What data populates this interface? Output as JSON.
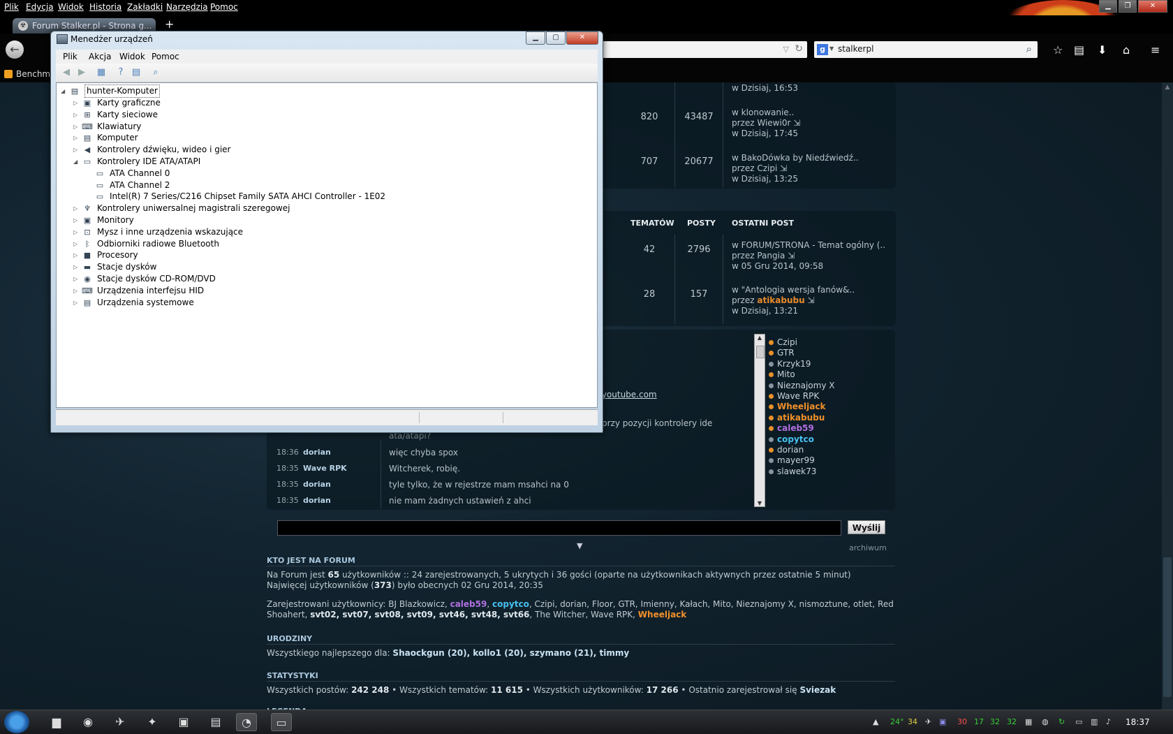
{
  "browser": {
    "menu": [
      "Plik",
      "Edycja",
      "Widok",
      "Historia",
      "Zakładki",
      "Narzędzia",
      "Pomoc"
    ],
    "tab_title": "Forum Stalker.pl - Strona g...",
    "search_query": "stalkerpl",
    "bookmark": "Benchma"
  },
  "forum": {
    "topics": [
      {
        "topics": "",
        "posts": "",
        "last_in": "",
        "last_by": "",
        "last_when": "w Dzisiaj, 16:53"
      },
      {
        "topics": "820",
        "posts": "43487",
        "last_in": "w klonowanie..",
        "last_by": "przez Wiewi0r",
        "last_when": "w Dzisiaj, 17:45"
      },
      {
        "topics": "707",
        "posts": "20677",
        "last_in": "w BakoDówka by Niedźwiedź..",
        "last_by": "przez Czipi",
        "last_when": "w Dzisiaj, 13:25"
      }
    ],
    "columns": {
      "topics": "TEMATÓW",
      "posts": "POSTY",
      "last": "OSTATNI POST"
    },
    "topics2": [
      {
        "topics": "42",
        "posts": "2796",
        "last_in": "w FORUM/STRONA - Temat ogólny (..",
        "last_by_prefix": "przez",
        "last_by": "Pangia",
        "last_when": "w 05 Gru 2014, 09:58"
      },
      {
        "topics": "28",
        "posts": "157",
        "last_in": "w \"Antologia wersja fanów&..",
        "last_by_prefix": "przez",
        "last_by": "atikabubu",
        "last_when": "w Dzisiaj, 13:21"
      }
    ]
  },
  "chat": {
    "users": [
      {
        "name": "Czipi",
        "style": "normal",
        "dot": "orange"
      },
      {
        "name": "GTR",
        "style": "normal",
        "dot": "orange"
      },
      {
        "name": "Krzyk19",
        "style": "normal",
        "dot": "grey"
      },
      {
        "name": "Mito",
        "style": "normal",
        "dot": "orange"
      },
      {
        "name": "Nieznajomy X",
        "style": "normal",
        "dot": "grey"
      },
      {
        "name": "Wave RPK",
        "style": "normal",
        "dot": "orange"
      },
      {
        "name": "Wheeljack",
        "style": "orange",
        "dot": "orange"
      },
      {
        "name": "atikabubu",
        "style": "orange",
        "dot": "orange"
      },
      {
        "name": "caleb59",
        "style": "purple",
        "dot": "orange"
      },
      {
        "name": "copytco",
        "style": "blue",
        "dot": "grey"
      },
      {
        "name": "dorian",
        "style": "normal",
        "dot": "orange"
      },
      {
        "name": "mayer99",
        "style": "normal",
        "dot": "grey"
      },
      {
        "name": "slawek73",
        "style": "normal",
        "dot": "grey"
      }
    ],
    "partial_link": ".youtube.com",
    "partial_msg_1": "przy pozycji kontrolery ide",
    "partial_msg_2": "ata/atapi?",
    "messages": [
      {
        "time": "18:36",
        "user": "dorian",
        "text": "więc chyba spox"
      },
      {
        "time": "18:35",
        "user": "Wave RPK",
        "text": "Witcherek, robię."
      },
      {
        "time": "18:35",
        "user": "dorian",
        "text": "tyle tylko, że w rejestrze mam msahci na 0"
      },
      {
        "time": "18:35",
        "user": "dorian",
        "text": "nie mam żadnych ustawień z ahci"
      }
    ],
    "send_label": "Wyślij",
    "archive_label": "archiwum"
  },
  "who": {
    "title": "KTO JEST NA FORUM",
    "line1_a": "Na Forum jest ",
    "line1_b": "65",
    "line1_c": " użytkowników :: 24 zarejestrowanych, 5 ukrytych i 36 gości (oparte na użytkownikach aktywnych przez ostatnie 5 minut)",
    "line2_a": "Najwięcej użytkowników (",
    "line2_b": "373",
    "line2_c": ") było obecnych 02 Gru 2014, 20:35",
    "reg_prefix": "Zarejestrowani użytkownicy: BJ Blazkowicz, ",
    "reg_c59": "caleb59",
    "reg_sep": ", ",
    "reg_cpy": "copytco",
    "reg_rest1": ", Czipi, dorian, Floor, GTR, Imienny, Kałach, Mito, Nieznajomy X, nismoztune, otlet, Red",
    "reg_line2_a": "Shoahert, ",
    "reg_line2_bold": "svt02, svt07, svt08, svt09, svt46, svt48, svt66",
    "reg_line2_b": ", The Witcher, Wave RPK, ",
    "reg_line2_orange": "Wheeljack"
  },
  "birthdays": {
    "title": "URODZINY",
    "prefix": "Wszystkiego najlepszego dla: ",
    "names": "Shaockgun (20), kollo1 (20), szymano (21), timmy"
  },
  "stats": {
    "title": "STATYSTYKI",
    "p1": "Wszystkich postów: ",
    "v1": "242 248",
    "p2": " • Wszystkich tematów: ",
    "v2": "11 615",
    "p3": " • Wszystkich użytkowników: ",
    "v3": "17 266",
    "p4": " • Ostatnio zarejestrował się ",
    "v4": "Sviezak",
    "legend_partial": "LEGENDA"
  },
  "device_manager": {
    "title": "Menedżer urządzeń",
    "menu": [
      "Plik",
      "Akcja",
      "Widok",
      "Pomoc"
    ],
    "root": "hunter-Komputer",
    "nodes": [
      {
        "label": "Karty graficzne",
        "level": 1,
        "expander": "▷",
        "icon": "display-adapter-icon",
        "glyph": "▣"
      },
      {
        "label": "Karty sieciowe",
        "level": 1,
        "expander": "▷",
        "icon": "network-adapter-icon",
        "glyph": "⊞"
      },
      {
        "label": "Klawiatury",
        "level": 1,
        "expander": "▷",
        "icon": "keyboard-icon",
        "glyph": "⌨"
      },
      {
        "label": "Komputer",
        "level": 1,
        "expander": "▷",
        "icon": "computer-icon",
        "glyph": "▤"
      },
      {
        "label": "Kontrolery dźwięku, wideo i gier",
        "level": 1,
        "expander": "▷",
        "icon": "speaker-icon",
        "glyph": "◀"
      },
      {
        "label": "Kontrolery IDE ATA/ATAPI",
        "level": 1,
        "expander": "◢",
        "icon": "ide-controller-icon",
        "glyph": "▭"
      },
      {
        "label": "ATA Channel 0",
        "level": 2,
        "expander": "",
        "icon": "ide-channel-icon",
        "glyph": "▭"
      },
      {
        "label": "ATA Channel 2",
        "level": 2,
        "expander": "",
        "icon": "ide-channel-icon",
        "glyph": "▭"
      },
      {
        "label": "Intel(R) 7 Series/C216 Chipset Family SATA AHCI Controller - 1E02",
        "level": 2,
        "expander": "",
        "icon": "sata-controller-icon",
        "glyph": "▭"
      },
      {
        "label": "Kontrolery uniwersalnej magistrali szeregowej",
        "level": 1,
        "expander": "▷",
        "icon": "usb-icon",
        "glyph": "♆"
      },
      {
        "label": "Monitory",
        "level": 1,
        "expander": "▷",
        "icon": "monitor-icon",
        "glyph": "▣"
      },
      {
        "label": "Mysz i inne urządzenia wskazujące",
        "level": 1,
        "expander": "▷",
        "icon": "mouse-icon",
        "glyph": "⊡"
      },
      {
        "label": "Odbiorniki radiowe Bluetooth",
        "level": 1,
        "expander": "▷",
        "icon": "bluetooth-icon",
        "glyph": "ᛒ"
      },
      {
        "label": "Procesory",
        "level": 1,
        "expander": "▷",
        "icon": "processor-icon",
        "glyph": "■"
      },
      {
        "label": "Stacje dysków",
        "level": 1,
        "expander": "▷",
        "icon": "disk-drive-icon",
        "glyph": "▬"
      },
      {
        "label": "Stacje dysków CD-ROM/DVD",
        "level": 1,
        "expander": "▷",
        "icon": "cdrom-icon",
        "glyph": "◉"
      },
      {
        "label": "Urządzenia interfejsu HID",
        "level": 1,
        "expander": "▷",
        "icon": "hid-icon",
        "glyph": "⌨"
      },
      {
        "label": "Urządzenia systemowe",
        "level": 1,
        "expander": "▷",
        "icon": "system-devices-icon",
        "glyph": "▤"
      }
    ]
  },
  "taskbar": {
    "tray": [
      "24°",
      "34",
      "30",
      "17",
      "32",
      "32"
    ],
    "clock": "18:37"
  }
}
